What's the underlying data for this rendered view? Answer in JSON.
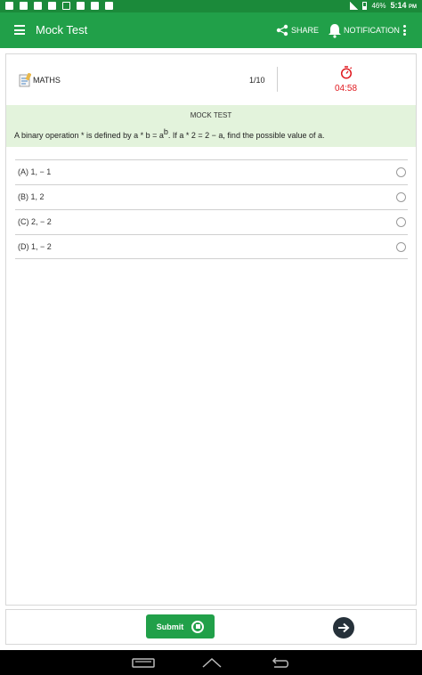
{
  "status_bar": {
    "battery": "46%",
    "time": "5:14",
    "time_suffix": "PM"
  },
  "app_bar": {
    "title": "Mock Test",
    "share_label": "SHARE",
    "notification_label": "NOTIFICATION"
  },
  "test_header": {
    "subject": "MATHS",
    "question_counter": "1/10",
    "timer": "04:58",
    "timer_color": "#e0191f"
  },
  "question": {
    "section_label": "MOCK TEST",
    "text_before_sup": "A binary operation * is defined by a * b = a",
    "superscript": "b",
    "text_after_sup": ". If a * 2 = 2 − a, find the possible value of a."
  },
  "options": [
    {
      "label": "(A) 1, − 1"
    },
    {
      "label": "(B) 1, 2"
    },
    {
      "label": "(C) 2, − 2"
    },
    {
      "label": "(D) 1, − 2"
    }
  ],
  "footer": {
    "submit_label": "Submit"
  },
  "colors": {
    "primary": "#21a049",
    "status_bar": "#1b8a3a",
    "question_bg": "#e3f3dc",
    "next_button": "#26313a"
  }
}
